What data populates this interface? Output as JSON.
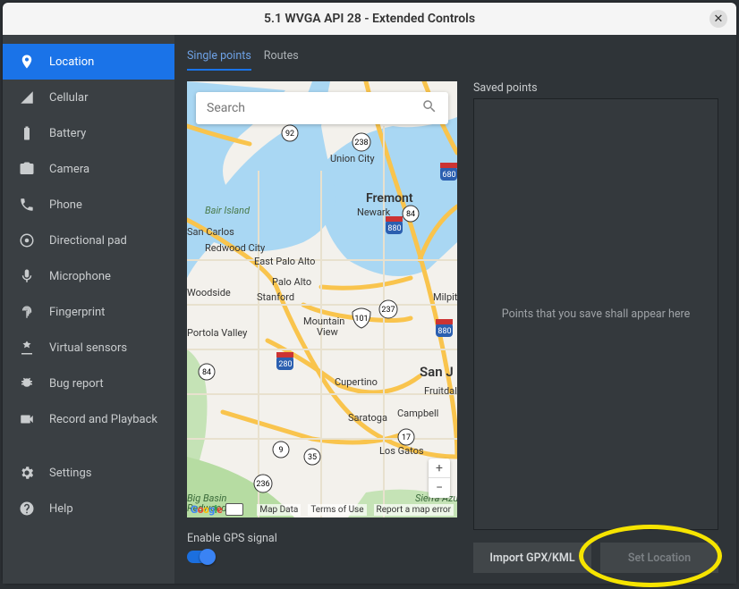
{
  "window": {
    "title": "5.1  WVGA API 28 - Extended Controls"
  },
  "sidebar": {
    "items": [
      {
        "label": "Location"
      },
      {
        "label": "Cellular"
      },
      {
        "label": "Battery"
      },
      {
        "label": "Camera"
      },
      {
        "label": "Phone"
      },
      {
        "label": "Directional pad"
      },
      {
        "label": "Microphone"
      },
      {
        "label": "Fingerprint"
      },
      {
        "label": "Virtual sensors"
      },
      {
        "label": "Bug report"
      },
      {
        "label": "Record and Playback"
      },
      {
        "label": "Settings"
      },
      {
        "label": "Help"
      }
    ]
  },
  "tabs": {
    "single": "Single points",
    "routes": "Routes"
  },
  "search": {
    "placeholder": "Search"
  },
  "map": {
    "labels": {
      "unioncity": "Union City",
      "fremont": "Fremont",
      "newark": "Newark",
      "bair": "Bair Island",
      "sancarlos": "San Carlos",
      "redwood": "Redwood City",
      "epa": "East Palo Alto",
      "woodside": "Woodside",
      "paloalto": "Palo Alto",
      "stanford": "Stanford",
      "mtview": "Mountain\nView",
      "milpitas": "Milpitas",
      "portola": "Portola Valley",
      "sanj": "San J",
      "cupertino": "Cupertino",
      "fruitdale": "Fruitdale",
      "saratoga": "Saratoga",
      "campbell": "Campbell",
      "losgatos": "Los Gatos",
      "bigbasin": "Big Basin\nRedwoods",
      "sierraazul": "Sierra Azul"
    },
    "shields": {
      "r92": "92",
      "r238": "238",
      "r680": "680",
      "r84a": "84",
      "r880a": "880",
      "r101a": "101",
      "r237": "237",
      "r880b": "880",
      "r84b": "84",
      "r280": "280",
      "r9": "9",
      "r35": "35",
      "r17": "17",
      "r236": "236"
    },
    "footer": {
      "mapdata": "Map Data",
      "terms": "Terms of Use",
      "report": "Report a map error"
    },
    "zoom": {
      "in": "+",
      "out": "−"
    }
  },
  "gps": {
    "label": "Enable GPS signal"
  },
  "saved": {
    "label": "Saved points",
    "placeholder": "Points that you save shall appear here"
  },
  "buttons": {
    "import": "Import GPX/KML",
    "setloc": "Set Location"
  }
}
